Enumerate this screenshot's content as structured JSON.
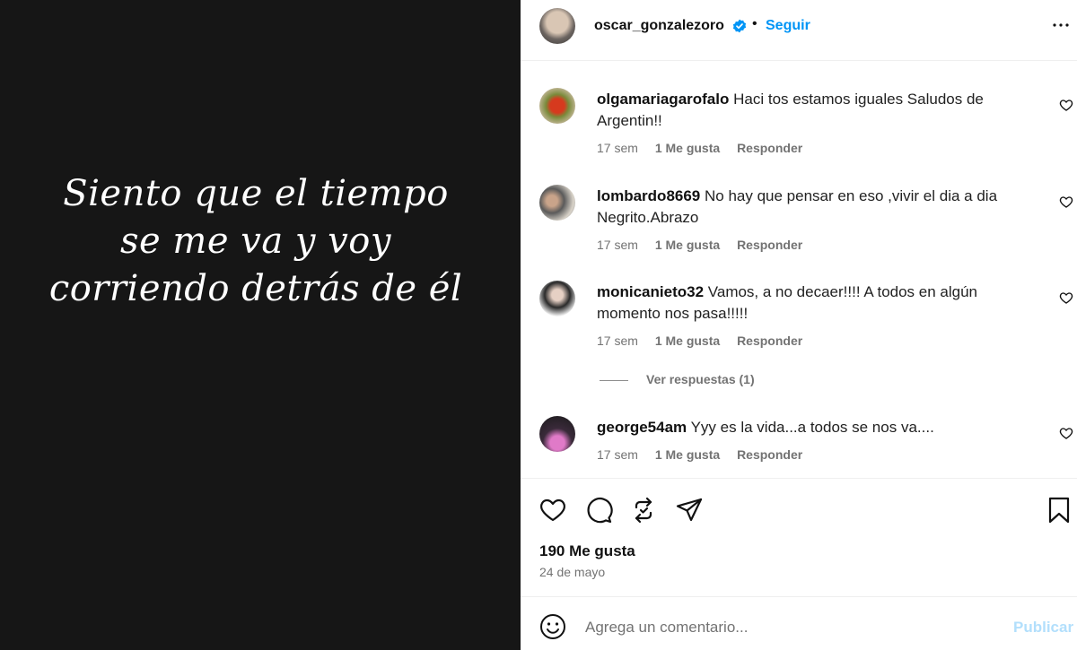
{
  "post": {
    "quote": "Siento que el tiempo se me va y voy corriendo detrás de él"
  },
  "header": {
    "username": "oscar_gonzalezoro",
    "separator": "•",
    "follow_label": "Seguir"
  },
  "comments": [
    {
      "username": "olgamariagarofalo",
      "text": "Haci tos estamos iguales Saludos de Argentin!!",
      "time": "17 sem",
      "likes": "1 Me gusta",
      "reply_label": "Responder"
    },
    {
      "username": "lombardo8669",
      "text": "No hay que pensar en eso ,vivir el dia a dia Negrito.Abrazo",
      "time": "17 sem",
      "likes": "1 Me gusta",
      "reply_label": "Responder"
    },
    {
      "username": "monicanieto32",
      "text": "Vamos, a no decaer!!!! A todos en algún momento nos pasa!!!!!",
      "time": "17 sem",
      "likes": "1 Me gusta",
      "reply_label": "Responder"
    },
    {
      "username": "george54am",
      "text": "Yyy es la vida...a todos se nos va....",
      "time": "17 sem",
      "likes": "1 Me gusta",
      "reply_label": "Responder"
    }
  ],
  "view_replies_label": "Ver respuestas (1)",
  "stats": {
    "likes": "190 Me gusta",
    "date": "24 de mayo"
  },
  "add_comment": {
    "placeholder": "Agrega un comentario...",
    "publish_label": "Publicar"
  },
  "icons": {
    "verified": "verified-badge-icon",
    "more": "more-options-icon",
    "like": "heart-icon",
    "comment": "comment-icon",
    "repost": "repost-icon",
    "share": "share-icon",
    "save": "bookmark-icon",
    "emoji": "emoji-icon"
  },
  "colors": {
    "accent": "#0095f6",
    "publish_disabled": "#b2dffc",
    "muted": "#737373",
    "post_background": "#161616"
  }
}
